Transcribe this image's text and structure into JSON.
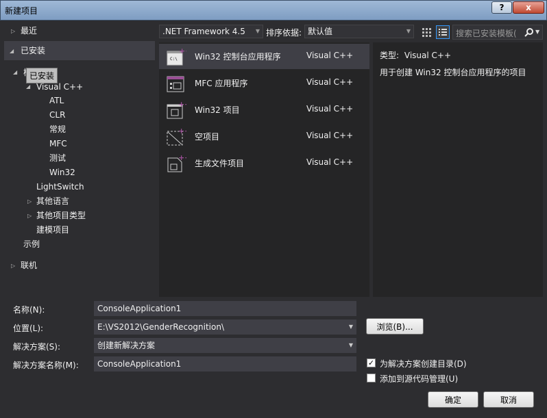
{
  "window": {
    "title": "新建项目",
    "help_label": "?",
    "close_label": "x"
  },
  "tree": {
    "recent": "最近",
    "installed": "已安装",
    "templates": "模板",
    "tooltip": "已安装",
    "visual_cpp": "Visual C++",
    "children": [
      "ATL",
      "CLR",
      "常规",
      "MFC",
      "测试",
      "Win32"
    ],
    "lightswitch": "LightSwitch",
    "other_languages": "其他语言",
    "other_project_types": "其他项目类型",
    "modeling_projects": "建模项目",
    "samples": "示例",
    "online": "联机"
  },
  "toolbar": {
    "framework": ".NET Framework 4.5",
    "sort_label": "排序依据:",
    "sort_value": "默认值",
    "search_placeholder": "搜索已安装模板("
  },
  "templates": [
    {
      "name": "Win32 控制台应用程序",
      "lang": "Visual C++",
      "icon": "console-app-icon"
    },
    {
      "name": "MFC 应用程序",
      "lang": "Visual C++",
      "icon": "mfc-app-icon"
    },
    {
      "name": "Win32 项目",
      "lang": "Visual C++",
      "icon": "win32-project-icon"
    },
    {
      "name": "空项目",
      "lang": "Visual C++",
      "icon": "empty-project-icon"
    },
    {
      "name": "生成文件项目",
      "lang": "Visual C++",
      "icon": "makefile-project-icon"
    }
  ],
  "info": {
    "type_label": "类型:",
    "type_value": "Visual C++",
    "description": "用于创建 Win32 控制台应用程序的项目"
  },
  "form": {
    "name_label": "名称(N):",
    "name_value": "ConsoleApplication1",
    "location_label": "位置(L):",
    "location_value": "E:\\VS2012\\GenderRecognition\\",
    "solution_label": "解决方案(S):",
    "solution_value": "创建新解决方案",
    "solution_name_label": "解决方案名称(M):",
    "solution_name_value": "ConsoleApplication1",
    "browse_label": "浏览(B)...",
    "create_dir_label": "为解决方案创建目录(D)",
    "add_source_control_label": "添加到源代码管理(U)",
    "ok_label": "确定",
    "cancel_label": "取消"
  },
  "colors": {
    "accent": "#68217a",
    "panel": "#252526",
    "selected": "#3f3f46"
  }
}
